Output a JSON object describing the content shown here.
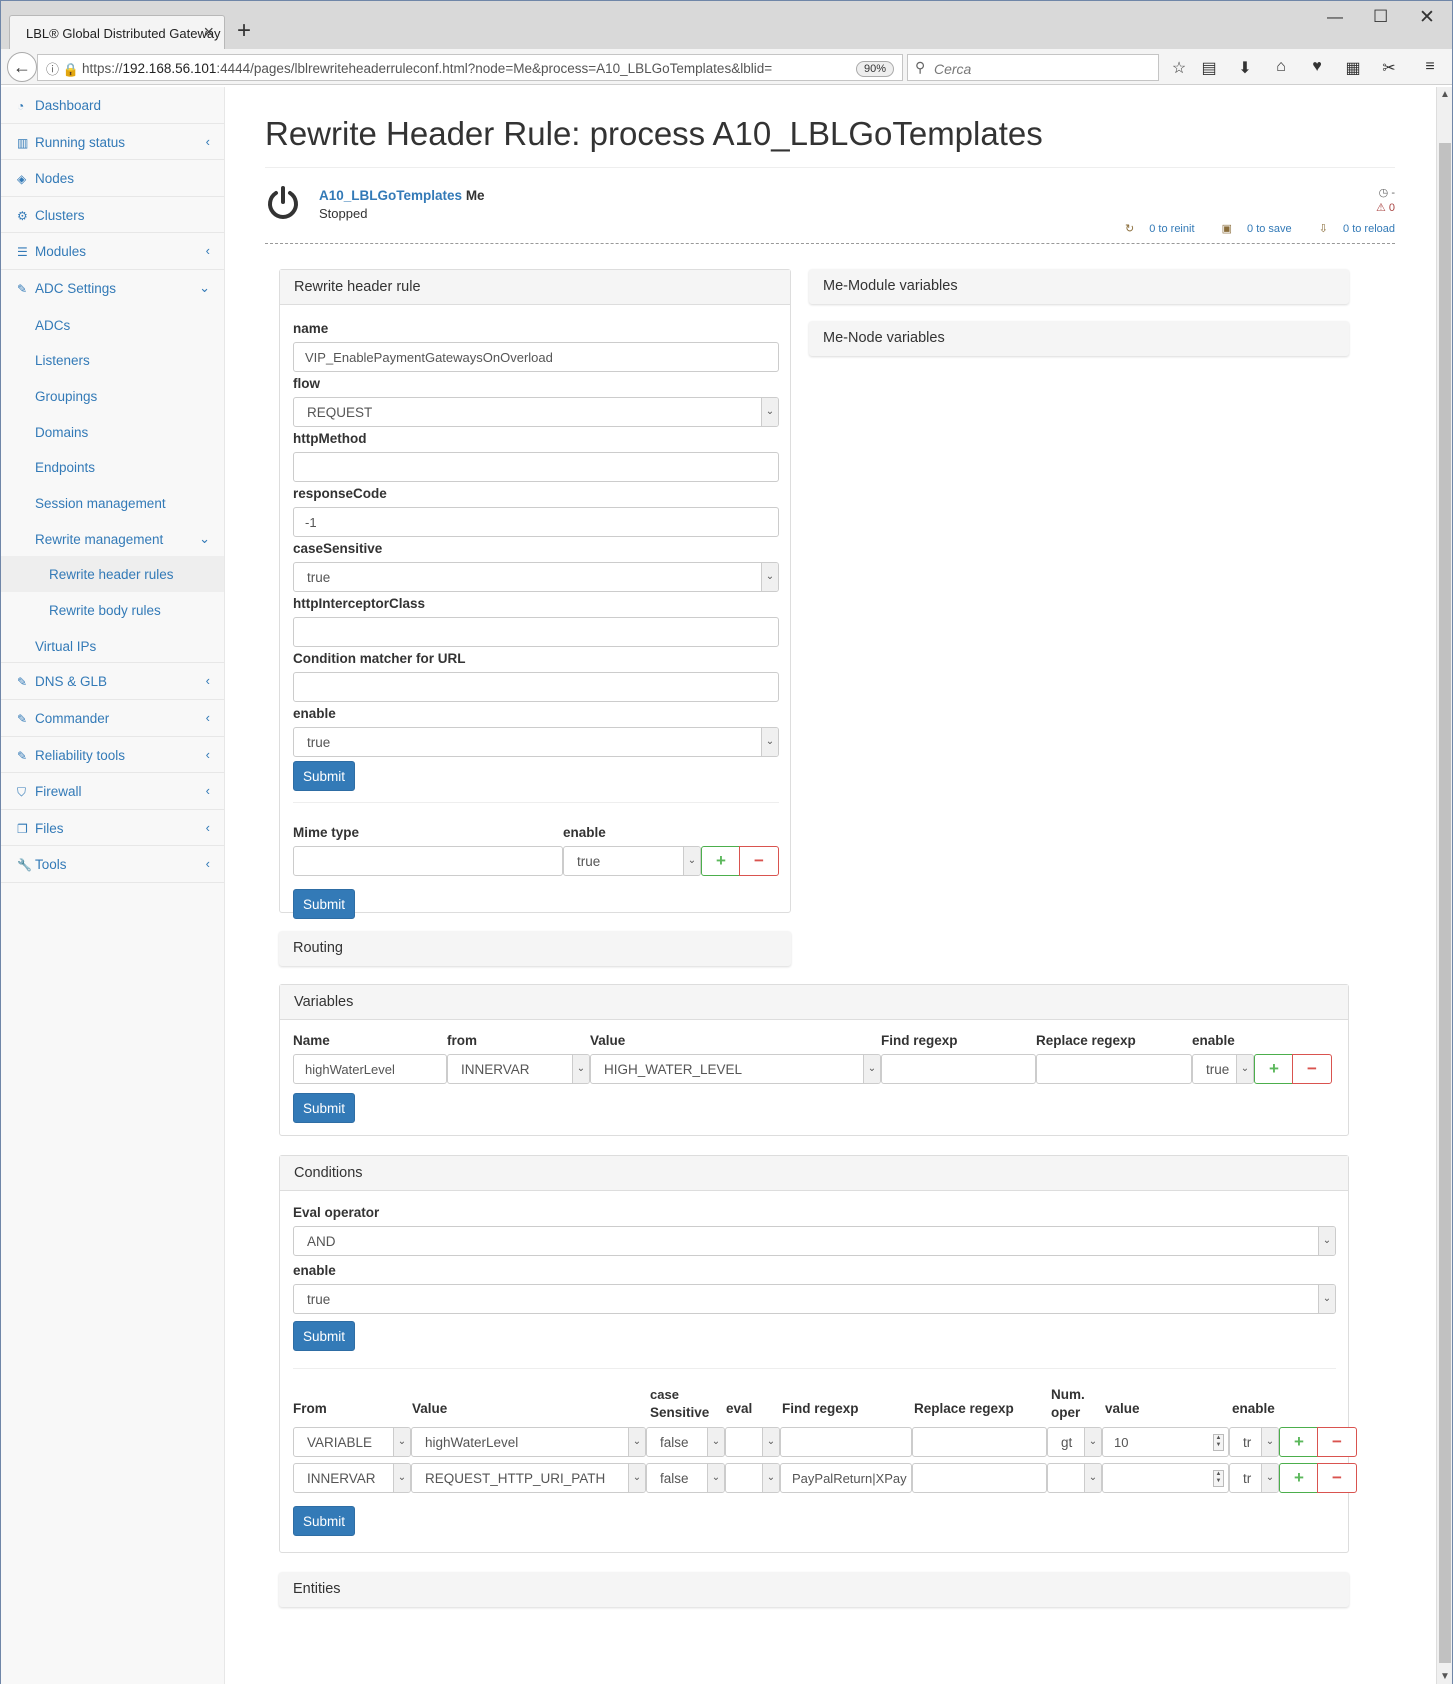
{
  "browser": {
    "tab_title": "LBL® Global Distributed Gateway",
    "url_prefix": "https://",
    "url_host": "192.168.56.101",
    "url_rest": ":4444/pages/lblrewriteheaderruleconf.html?node=Me&process=A10_LBLGoTemplates&lblid=",
    "zoom": "90%",
    "search_placeholder": "Cerca"
  },
  "sidebar": {
    "items": [
      {
        "label": "Dashboard",
        "icon": "dashboard-icon"
      },
      {
        "label": "Running status",
        "icon": "bar-chart-icon"
      },
      {
        "label": "Nodes",
        "icon": "cube-icon"
      },
      {
        "label": "Clusters",
        "icon": "cogs-icon"
      },
      {
        "label": "Modules",
        "icon": "list-icon"
      },
      {
        "label": "ADC Settings",
        "icon": "edit-icon"
      }
    ],
    "adc_sub": [
      "ADCs",
      "Listeners",
      "Groupings",
      "Domains",
      "Endpoints",
      "Session management",
      "Rewrite management"
    ],
    "rewrite_sub": [
      "Rewrite header rules",
      "Rewrite body rules"
    ],
    "virtual_ips": "Virtual IPs",
    "bottom_items": [
      {
        "label": "DNS & GLB",
        "icon": "edit-icon"
      },
      {
        "label": "Commander",
        "icon": "edit-icon"
      },
      {
        "label": "Reliability tools",
        "icon": "edit-icon"
      },
      {
        "label": "Firewall",
        "icon": "shield-icon"
      },
      {
        "label": "Files",
        "icon": "files-icon"
      },
      {
        "label": "Tools",
        "icon": "wrench-icon"
      }
    ]
  },
  "page": {
    "title": "Rewrite Header Rule: process A10_LBLGoTemplates",
    "process_name": "A10_LBLGoTemplates",
    "node_name": "Me",
    "process_state": "Stopped",
    "status_clock": "-",
    "status_warn": "0",
    "to_reinit": "0 to reinit",
    "to_save": "0 to save",
    "to_reload": "0 to reload"
  },
  "rule_panel": {
    "title": "Rewrite header rule",
    "name_label": "name",
    "name_value": "VIP_EnablePaymentGatewaysOnOverload",
    "flow_label": "flow",
    "flow_value": "REQUEST",
    "httpMethod_label": "httpMethod",
    "httpMethod_value": "",
    "responseCode_label": "responseCode",
    "responseCode_value": "-1",
    "caseSensitive_label": "caseSensitive",
    "caseSensitive_value": "true",
    "interceptor_label": "httpInterceptorClass",
    "interceptor_value": "",
    "condition_label": "Condition matcher for URL",
    "condition_value": "",
    "enable_label": "enable",
    "enable_value": "true",
    "submit": "Submit",
    "mime_label": "Mime type",
    "mime_value": "",
    "mime_enable_label": "enable",
    "mime_enable_value": "true",
    "mime_submit": "Submit"
  },
  "module_vars_title": "Me-Module variables",
  "node_vars_title": "Me-Node variables",
  "routing_title": "Routing",
  "variables": {
    "title": "Variables",
    "headers": [
      "Name",
      "from",
      "Value",
      "Find regexp",
      "Replace regexp",
      "enable"
    ],
    "row": {
      "name": "highWaterLevel",
      "from": "INNERVAR",
      "value": "HIGH_WATER_LEVEL",
      "find": "",
      "replace": "",
      "enable": "true"
    },
    "submit": "Submit"
  },
  "conditions": {
    "title": "Conditions",
    "eval_label": "Eval operator",
    "eval_value": "AND",
    "enable_label": "enable",
    "enable_value": "true",
    "submit": "Submit",
    "headers": {
      "from": "From",
      "value": "Value",
      "case1": "case",
      "case2": "Sensitive",
      "eval": "eval",
      "find": "Find regexp",
      "replace": "Replace regexp",
      "num1": "Num.",
      "num2": "oper",
      "val": "value",
      "enable": "enable"
    },
    "rows": [
      {
        "from": "VARIABLE",
        "value": "highWaterLevel",
        "case": "false",
        "eval": "",
        "find": "",
        "replace": "",
        "num": "gt",
        "val": "10",
        "enable": "tr"
      },
      {
        "from": "INNERVAR",
        "value": "REQUEST_HTTP_URI_PATH",
        "case": "false",
        "eval": "",
        "find": "PayPalReturn|XPay",
        "replace": "",
        "num": "",
        "val": "",
        "enable": "tr"
      }
    ],
    "rows_submit": "Submit"
  },
  "entities_title": "Entities"
}
